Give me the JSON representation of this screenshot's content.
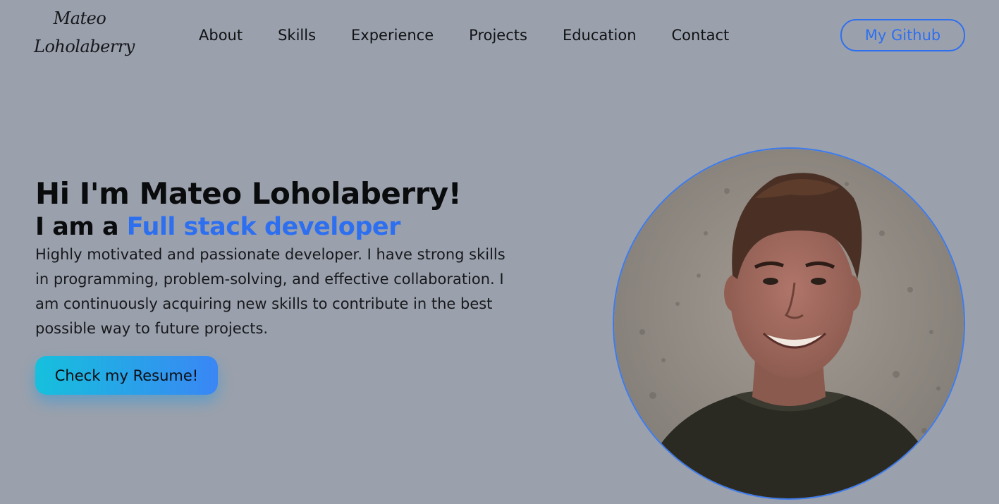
{
  "header": {
    "logo_line1": "Mateo",
    "logo_line2": "Loholaberry",
    "nav": [
      {
        "label": "About"
      },
      {
        "label": "Skills"
      },
      {
        "label": "Experience"
      },
      {
        "label": "Projects"
      },
      {
        "label": "Education"
      },
      {
        "label": "Contact"
      }
    ],
    "github_label": "My Github"
  },
  "hero": {
    "title": "Hi I'm Mateo Loholaberry!",
    "subtitle_prefix": "I am a ",
    "subtitle_accent": "Full stack developer",
    "description": "Highly motivated and passionate developer. I have strong skills in programming, problem-solving, and effective collaboration. I am continuously acquiring new skills to contribute in the best possible way to future projects.",
    "resume_label": "Check my Resume!"
  },
  "colors": {
    "background": "#9ba1ac",
    "accent": "#2e6ff0",
    "button_gradient_start": "#16c0dc",
    "button_gradient_end": "#3a86f5"
  },
  "icons": {
    "portrait": "profile-photo"
  }
}
